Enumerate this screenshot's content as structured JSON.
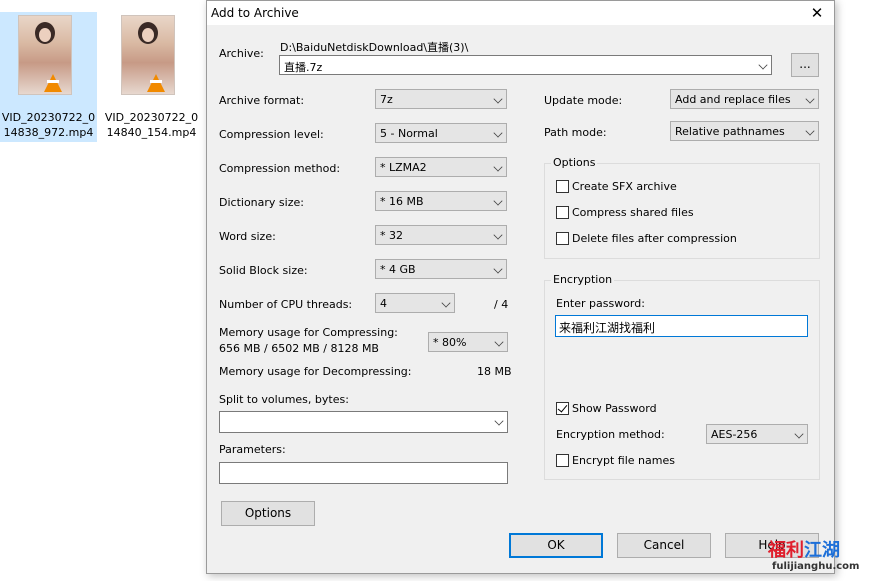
{
  "desktop": {
    "files": [
      {
        "name": "VID_20230722_014838_972.mp4",
        "selected": true
      },
      {
        "name": "VID_20230722_014840_154.mp4",
        "selected": false
      }
    ]
  },
  "dialog": {
    "title": "Add to Archive",
    "archive_label": "Archive:",
    "archive_path": "D:\\BaiduNetdiskDownload\\直播(3)\\",
    "archive_name": "直播.7z",
    "browse_label": "...",
    "format_label": "Archive format:",
    "format_value": "7z",
    "compression_level_label": "Compression level:",
    "compression_level_value": "5 - Normal",
    "compression_method_label": "Compression method:",
    "compression_method_value": "*  LZMA2",
    "dictionary_label": "Dictionary size:",
    "dictionary_value": "*  16 MB",
    "word_label": "Word size:",
    "word_value": "*  32",
    "solid_label": "Solid Block size:",
    "solid_value": "*  4 GB",
    "cpu_label": "Number of CPU threads:",
    "cpu_value": "4",
    "cpu_total": "/ 4",
    "mem_comp_label": "Memory usage for Compressing:",
    "mem_comp_values": "656 MB / 6502 MB / 8128 MB",
    "mem_comp_percent": "*  80%",
    "mem_decomp_label": "Memory usage for Decompressing:",
    "mem_decomp_value": "18 MB",
    "split_label": "Split to volumes, bytes:",
    "split_value": "",
    "params_label": "Parameters:",
    "params_value": "",
    "options_button": "Options",
    "update_mode_label": "Update mode:",
    "update_mode_value": "Add and replace files",
    "path_mode_label": "Path mode:",
    "path_mode_value": "Relative pathnames",
    "options_group": {
      "title": "Options",
      "sfx": {
        "label": "Create SFX archive",
        "checked": false
      },
      "shared": {
        "label": "Compress shared files",
        "checked": false
      },
      "delete": {
        "label": "Delete files after compression",
        "checked": false
      }
    },
    "encryption": {
      "title": "Encryption",
      "password_label": "Enter password:",
      "password_value": "来福利江湖找福利",
      "show_password": {
        "label": "Show Password",
        "checked": true
      },
      "method_label": "Encryption method:",
      "method_value": "AES-256",
      "encrypt_names": {
        "label": "Encrypt file names",
        "checked": false
      }
    },
    "ok_button": "OK",
    "cancel_button": "Cancel",
    "help_button": "Help"
  },
  "watermark": {
    "text_red": "福利",
    "text_blue": "江湖",
    "url": "fulijianghu.com"
  },
  "colors": {
    "accent": "#0078d7",
    "dialog_bg": "#f0f0f0",
    "selection": "#cce8ff"
  }
}
